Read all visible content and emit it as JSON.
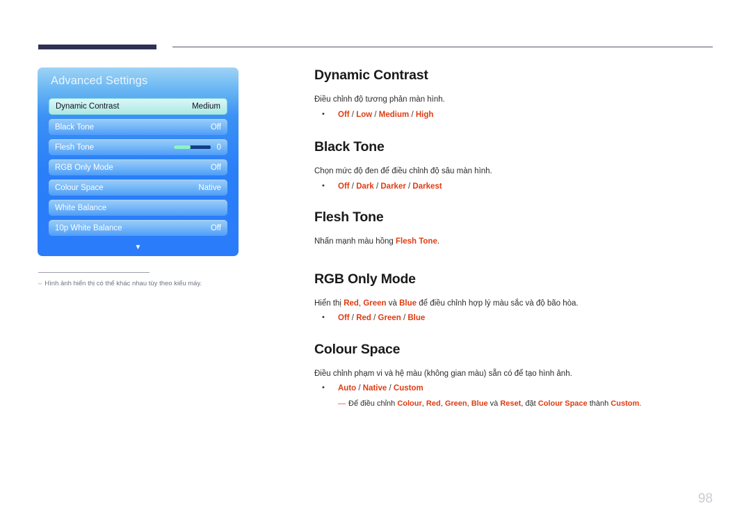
{
  "page": {
    "number": "98",
    "accent_red": "#e03b11"
  },
  "osd": {
    "title": "Advanced Settings",
    "rows": [
      {
        "label": "Dynamic Contrast",
        "value": "Medium",
        "selected": true,
        "type": "value"
      },
      {
        "label": "Black Tone",
        "value": "Off",
        "selected": false,
        "type": "value"
      },
      {
        "label": "Flesh Tone",
        "value": "0",
        "selected": false,
        "type": "slider",
        "slider_percent": 46
      },
      {
        "label": "RGB Only Mode",
        "value": "Off",
        "selected": false,
        "type": "value"
      },
      {
        "label": "Colour Space",
        "value": "Native",
        "selected": false,
        "type": "value"
      },
      {
        "label": "White Balance",
        "value": "",
        "selected": false,
        "type": "value"
      },
      {
        "label": "10p White Balance",
        "value": "Off",
        "selected": false,
        "type": "value"
      }
    ],
    "scroll_icon": "chevron-down-icon",
    "footnote_dash": "–",
    "footnote": "Hình ảnh hiển thị có thể khác nhau tùy theo kiểu máy."
  },
  "sections": {
    "dynamic_contrast": {
      "heading": "Dynamic Contrast",
      "desc": "Điều chỉnh độ tương phản màn hình.",
      "options": [
        "Off",
        "Low",
        "Medium",
        "High"
      ]
    },
    "black_tone": {
      "heading": "Black Tone",
      "desc": "Chọn mức độ đen để điều chỉnh độ sâu màn hình.",
      "options": [
        "Off",
        "Dark",
        "Darker",
        "Darkest"
      ]
    },
    "flesh_tone": {
      "heading": "Flesh Tone",
      "desc_pre": "Nhấn mạnh màu hồng ",
      "desc_kw": "Flesh Tone",
      "desc_post": "."
    },
    "rgb_only_mode": {
      "heading": "RGB Only Mode",
      "desc_pre": "Hiển thị ",
      "desc_kw1": "Red",
      "desc_mid1": ", ",
      "desc_kw2": "Green",
      "desc_mid2": " và ",
      "desc_kw3": "Blue",
      "desc_post": " để điều chỉnh hợp lý màu sắc và độ bão hòa.",
      "options": [
        "Off",
        "Red",
        "Green",
        "Blue"
      ]
    },
    "colour_space": {
      "heading": "Colour Space",
      "desc": "Điều chỉnh phạm vi và hệ màu (không gian màu) sẵn có để tạo hình ảnh.",
      "options": [
        "Auto",
        "Native",
        "Custom"
      ],
      "subnote": {
        "dash": "—",
        "t1": "Để điều chỉnh ",
        "k1": "Colour",
        "t2": ", ",
        "k2": "Red",
        "t3": ", ",
        "k3": "Green",
        "t4": ", ",
        "k4": "Blue",
        "t5": " và ",
        "k5": "Reset",
        "t6": ", đặt ",
        "k6": "Colour Space",
        "t7": " thành ",
        "k7": "Custom",
        "t8": "."
      }
    }
  }
}
